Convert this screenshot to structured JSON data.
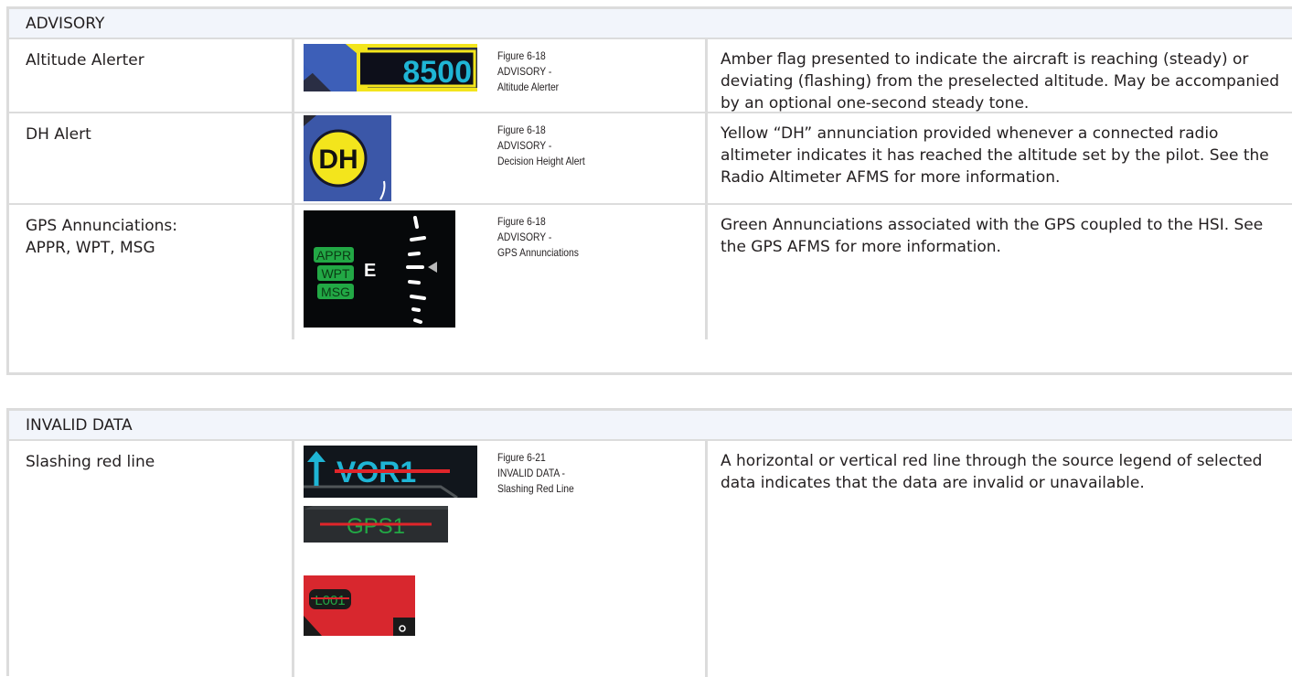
{
  "advisory": {
    "header": "ADVISORY",
    "rows": [
      {
        "name_lines": [
          "Altitude Alerter"
        ],
        "caption": [
          "Figure 6-18",
          "ADVISORY -",
          "Altitude Alerter"
        ],
        "description": "Amber flag presented to indicate the aircraft is reaching (steady) or deviating (flashing) from the preselected altitude. May be accompanied by an optional one-second steady tone.",
        "image": {
          "type": "altitude-alerter",
          "altitude_text": "8500"
        }
      },
      {
        "name_lines": [
          "DH Alert"
        ],
        "caption": [
          "Figure 6-18",
          "ADVISORY -",
          "Decision Height Alert"
        ],
        "description": "Yellow “DH” annunciation provided whenever a connected radio altimeter indicates it has reached the altitude set by the pilot.  See the Radio Altimeter AFMS for more information.",
        "image": {
          "type": "dh-alert",
          "label": "DH"
        }
      },
      {
        "name_lines": [
          "GPS Annunciations:",
          "APPR, WPT, MSG"
        ],
        "caption": [
          "Figure 6-18",
          "ADVISORY -",
          "GPS Annunciations"
        ],
        "description": "Green Annunciations associated with the GPS coupled to the HSI.  See the GPS AFMS for more information.",
        "image": {
          "type": "gps-annunciations",
          "labels": [
            "APPR",
            "WPT",
            "MSG"
          ],
          "heading": "E"
        }
      }
    ]
  },
  "invalid": {
    "header": "INVALID DATA",
    "rows": [
      {
        "name_lines": [
          "Slashing red line"
        ],
        "caption": [
          "Figure 6-21",
          "INVALID DATA -",
          "Slashing Red Line"
        ],
        "description": "A horizontal or vertical red line through the source legend of selected data indicates that the data are invalid or unavailable.",
        "images": [
          {
            "type": "vor-legend",
            "label": "VOR1"
          },
          {
            "type": "gps-legend",
            "label": "GPS1"
          },
          {
            "type": "loc-legend",
            "label": "L001"
          }
        ]
      }
    ]
  },
  "colors": {
    "header_bg": "#f2f5fb",
    "rule": "#dcdcdc",
    "cyan": "#1fb5d5",
    "annunciator_green": "#22a845",
    "invalid_red": "#e0252a",
    "dh_yellow": "#f0e01a"
  }
}
